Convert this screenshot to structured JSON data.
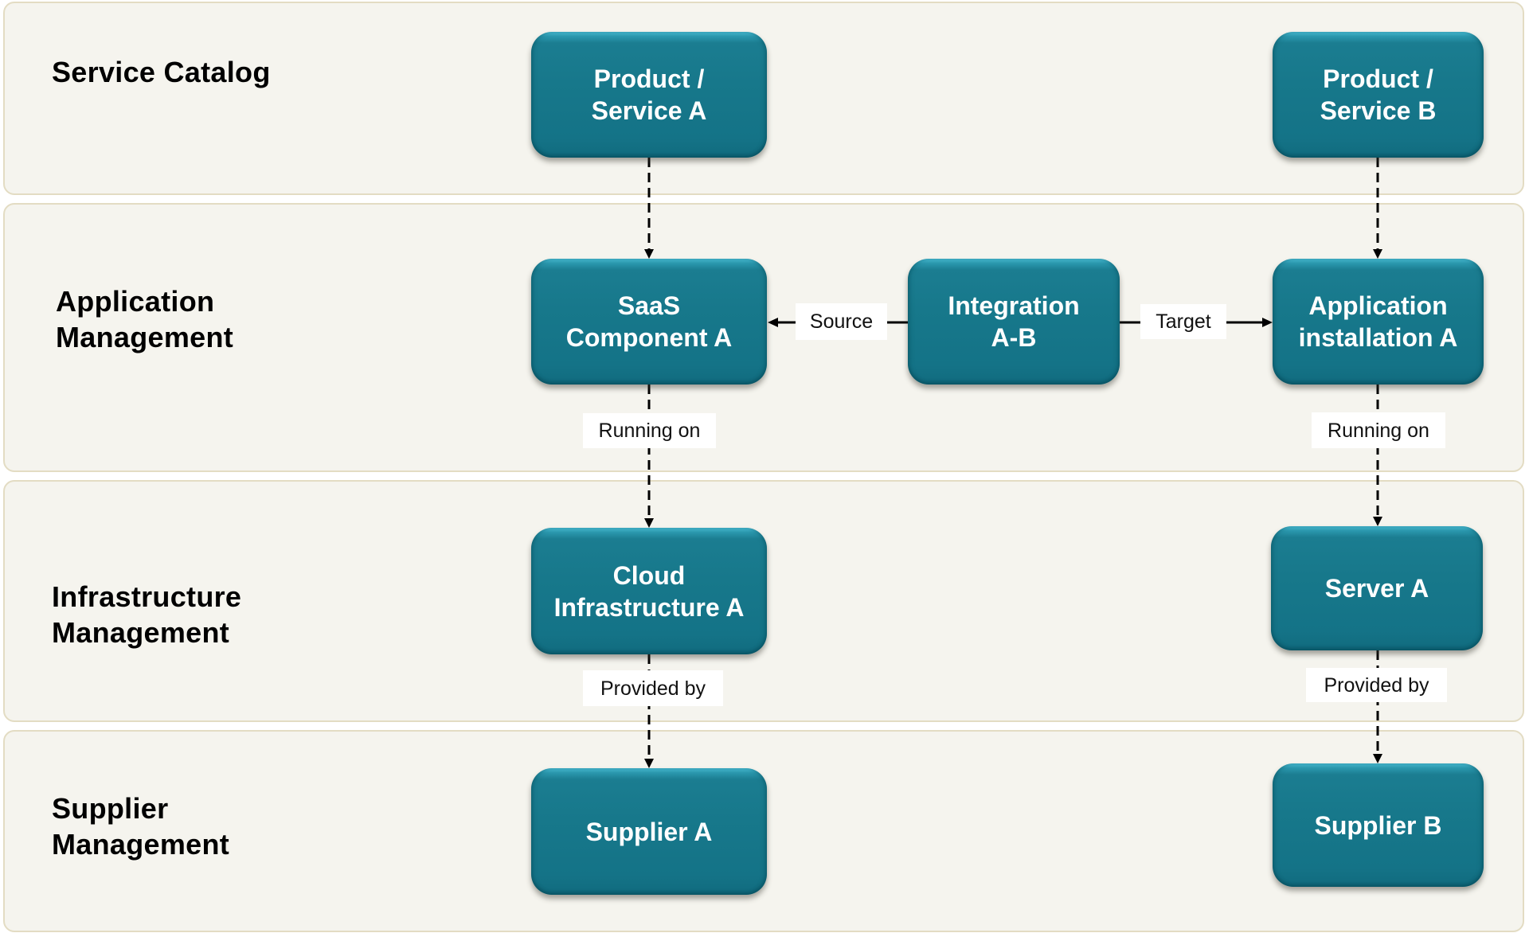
{
  "diagram": {
    "lanes": [
      {
        "id": "service-catalog",
        "title_lines": [
          "Service Catalog"
        ]
      },
      {
        "id": "application-management",
        "title_lines": [
          "Application",
          "Management"
        ]
      },
      {
        "id": "infrastructure-management",
        "title_lines": [
          "Infrastructure",
          "Management"
        ]
      },
      {
        "id": "supplier-management",
        "title_lines": [
          "Supplier",
          "Management"
        ]
      }
    ],
    "nodes": {
      "product_service_a": {
        "label": "Product /\nService A",
        "lane": "service-catalog"
      },
      "product_service_b": {
        "label": "Product /\nService B",
        "lane": "service-catalog"
      },
      "saas_component_a": {
        "label": "SaaS\nComponent A",
        "lane": "application-management"
      },
      "integration_a_b": {
        "label": "Integration\nA-B",
        "lane": "application-management"
      },
      "application_installation_a": {
        "label": "Application\ninstallation A",
        "lane": "application-management"
      },
      "cloud_infrastructure_a": {
        "label": "Cloud\nInfrastructure A",
        "lane": "infrastructure-management"
      },
      "server_a": {
        "label": "Server A",
        "lane": "infrastructure-management"
      },
      "supplier_a": {
        "label": "Supplier A",
        "lane": "supplier-management"
      },
      "supplier_b": {
        "label": "Supplier B",
        "lane": "supplier-management"
      }
    },
    "edges": [
      {
        "from": "product_service_a",
        "to": "saas_component_a",
        "label": "",
        "style": "dashed"
      },
      {
        "from": "product_service_b",
        "to": "application_installation_a",
        "label": "",
        "style": "dashed"
      },
      {
        "from": "integration_a_b",
        "to": "saas_component_a",
        "label": "Source",
        "style": "solid"
      },
      {
        "from": "integration_a_b",
        "to": "application_installation_a",
        "label": "Target",
        "style": "solid"
      },
      {
        "from": "saas_component_a",
        "to": "cloud_infrastructure_a",
        "label": "Running on",
        "style": "dashed"
      },
      {
        "from": "application_installation_a",
        "to": "server_a",
        "label": "Running on",
        "style": "dashed"
      },
      {
        "from": "cloud_infrastructure_a",
        "to": "supplier_a",
        "label": "Provided by",
        "style": "dashed"
      },
      {
        "from": "server_a",
        "to": "supplier_b",
        "label": "Provided by",
        "style": "dashed"
      }
    ],
    "colors": {
      "node_fill": "#17788b",
      "node_highlight": "#4fc6df",
      "node_text": "#ffffff",
      "lane_fill": "#f5f4ee",
      "lane_border": "#e3dcc3",
      "connector": "#000000",
      "edge_label_bg": "#ffffff"
    }
  }
}
